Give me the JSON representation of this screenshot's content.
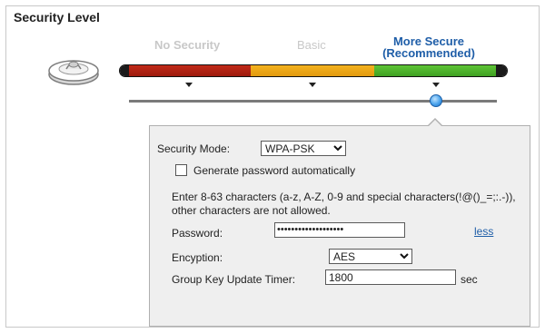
{
  "section": {
    "title": "Security Level"
  },
  "levels": {
    "none": "No Security",
    "basic": "Basic",
    "more_line1": "More Secure",
    "more_line2": "(Recommended)"
  },
  "slider": {
    "selected_level": "More Secure (Recommended)",
    "position_fraction": 0.83
  },
  "colors": {
    "red": "#b02214",
    "orange": "#f0a818",
    "green": "#4cb02a",
    "accent": "#1f5ea8"
  },
  "form": {
    "security_mode_label": "Security Mode:",
    "security_mode_value": "WPA-PSK",
    "generate_label": "Generate password automatically",
    "generate_checked": false,
    "note": "Enter 8-63 characters (a-z, A-Z, 0-9 and special characters(!@()_=;:.-)), other characters are not allowed.",
    "password_label": "Password:",
    "password_value": "•••••••••••••••••••",
    "less_link": "less",
    "encryption_label": "Encyption:",
    "encryption_value": "AES",
    "timer_label": "Group Key Update Timer:",
    "timer_value": "1800",
    "timer_unit": "sec"
  },
  "icons": {
    "router": "router-icon",
    "dropdown": "chevron-down-icon"
  }
}
